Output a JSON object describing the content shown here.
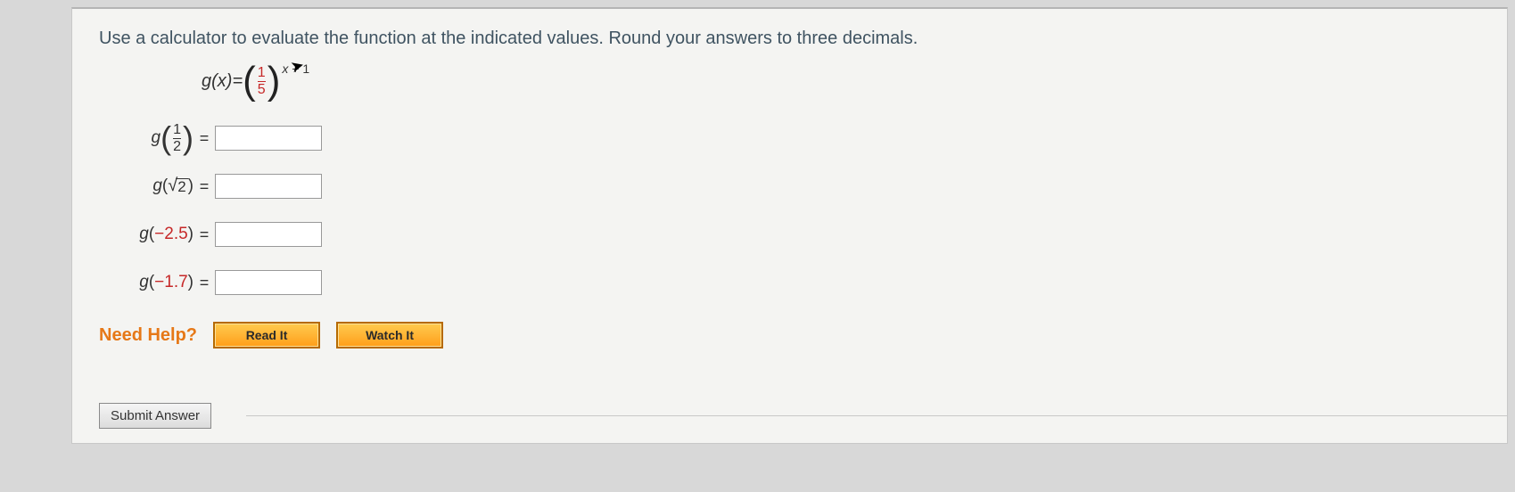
{
  "prompt": "Use a calculator to evaluate the function at the indicated values. Round your answers to three decimals.",
  "func": {
    "lhs_g": "g",
    "lhs_x": "(x)",
    "equals": " = ",
    "frac_num": "1",
    "frac_den": "5",
    "exp_var": "x",
    "exp_plus": " + 1"
  },
  "rows": [
    {
      "g": "g",
      "open": "(",
      "inner_type": "frac",
      "num": "1",
      "den": "2",
      "close": ")",
      "value": ""
    },
    {
      "g": "g",
      "open": "(",
      "inner_type": "sqrt",
      "arg": "2",
      "close": ")",
      "value": ""
    },
    {
      "g": "g",
      "open": "(",
      "inner_type": "num",
      "arg": "−2.5",
      "close": ")",
      "value": ""
    },
    {
      "g": "g",
      "open": "(",
      "inner_type": "num",
      "arg": "−1.7",
      "close": ")",
      "value": ""
    }
  ],
  "eq": "=",
  "help": {
    "label": "Need Help?",
    "read": "Read It",
    "watch": "Watch It"
  },
  "submit": "Submit Answer"
}
